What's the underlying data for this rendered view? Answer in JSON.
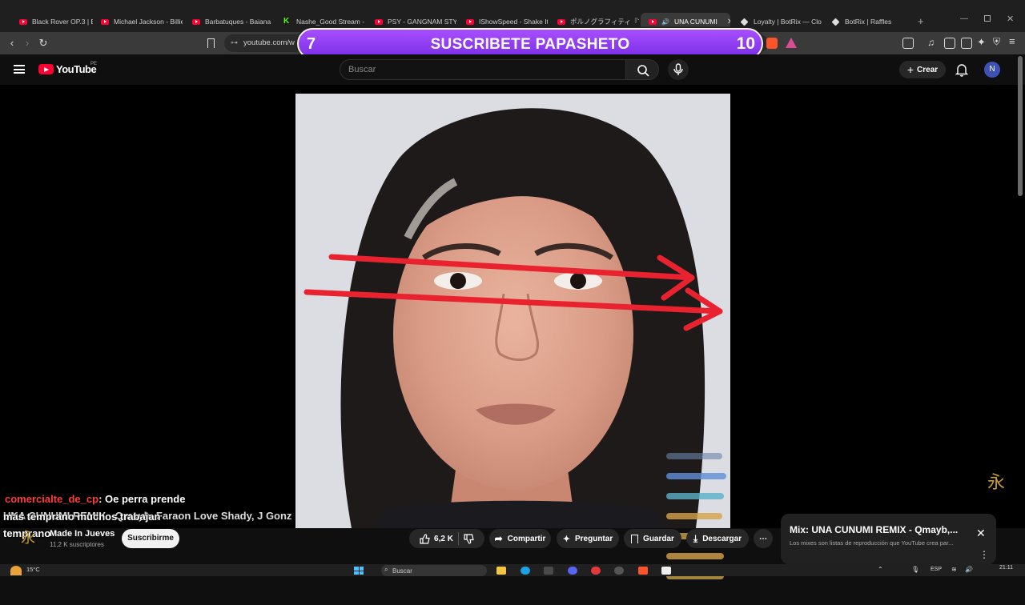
{
  "browser": {
    "tabs": [
      {
        "label": "Black Rover OP.3 | Blac",
        "icon": "youtube-icon"
      },
      {
        "label": "Michael Jackson - Billie",
        "icon": "youtube-icon"
      },
      {
        "label": "Barbatuques - Baiana",
        "icon": "youtube-icon"
      },
      {
        "label": "Nashe_Good Stream -",
        "icon": "kick-icon"
      },
      {
        "label": "PSY - GANGNAM STYL",
        "icon": "youtube-icon"
      },
      {
        "label": "IShowSpeed - Shake It",
        "icon": "youtube-icon"
      },
      {
        "label": "ポルノグラフィティ『THE RE",
        "icon": "youtube-icon"
      },
      {
        "label": "UNA CUNUMI",
        "icon": "youtube-icon",
        "active": true
      },
      {
        "label": "Loyalty | BotRix — Clo",
        "icon": "botrix-icon"
      },
      {
        "label": "BotRix | Raffles",
        "icon": "botrix-icon"
      }
    ],
    "url": "youtube.com/w"
  },
  "stream_overlay": {
    "left_number": "7",
    "text": "SUSCRIBETE PAPASHETO",
    "right_number": "10"
  },
  "youtube": {
    "logo_text": "YouTube",
    "region": "PE",
    "search_placeholder": "Buscar",
    "create_label": "Crear",
    "avatar_letter": "N"
  },
  "chat_overlay": {
    "username": "comercialte_de_cp",
    "message_line1": ": Oe perra prende",
    "message_line2": "más temprano muchos trabajan",
    "message_line3": "temprano",
    "video_title_fragment": "UNA CUNUMI REMIX - Qmayb, Faraon Love Shady, J Gonz"
  },
  "channel": {
    "name": "Made In Jueves",
    "subscribers": "11,2 K suscriptores",
    "subscribe_label": "Suscribirme"
  },
  "actions": {
    "likes": "6,2 K",
    "share": "Compartir",
    "ask": "Preguntar",
    "save": "Guardar",
    "download": "Descargar"
  },
  "mix_card": {
    "title": "Mix: UNA CUNUMI REMIX - Qmayb,...",
    "subtitle": "Los mixes son listas de reproducción que YouTube crea par..."
  },
  "taskbar": {
    "weather": "15°C",
    "search": "Buscar",
    "language": "ESP",
    "time": "21:11"
  },
  "colors": {
    "banner_purple": "#8a3cf0",
    "youtube_red": "#ff0033",
    "chat_username_red": "#ff3b3b",
    "arrow_red": "#e8232f"
  }
}
